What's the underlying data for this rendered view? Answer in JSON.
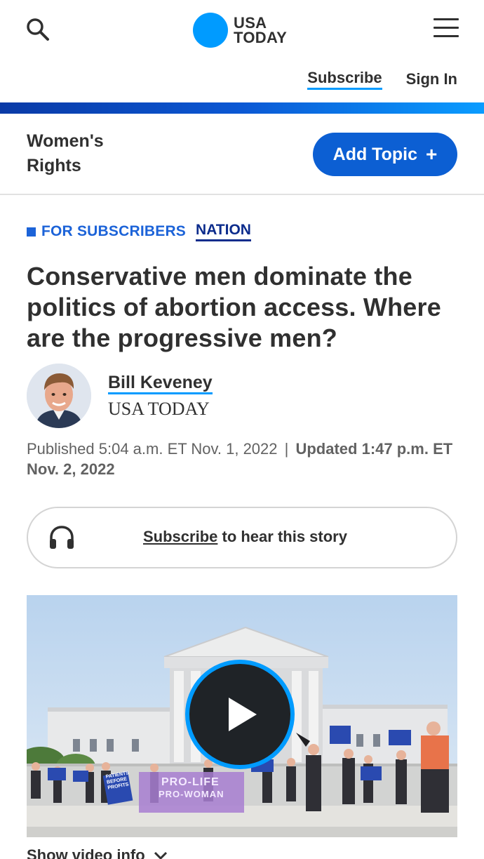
{
  "header": {
    "logo_line1": "USA",
    "logo_line2": "TODAY",
    "subscribe_label": "Subscribe",
    "signin_label": "Sign In",
    "brand_color": "#009bff"
  },
  "topic": {
    "title": "Women's Rights",
    "add_label": "Add Topic",
    "add_symbol": "+"
  },
  "labels": {
    "subscribers": "FOR SUBSCRIBERS",
    "section": "NATION"
  },
  "article": {
    "headline": "Conservative men dominate the politics of abortion access. Where are the progressive men?",
    "author_name": "Bill Keveney",
    "author_org": "USA TODAY",
    "published": "Published 5:04 a.m. ET Nov. 1, 2022",
    "separator": "|",
    "updated": "Updated 1:47 p.m. ET Nov. 2, 2022"
  },
  "listen": {
    "link_label": "Subscribe",
    "rest_label": " to hear this story",
    "icon": "headphones-icon"
  },
  "video": {
    "sign_1": "PRO-LIFE",
    "sign_2": "PRO-WOMAN",
    "sign_3": "PATIENTS BEFORE PROFITS",
    "play_icon": "play-icon"
  },
  "video_info": {
    "label": "Show video info",
    "icon": "chevron-down-icon"
  }
}
